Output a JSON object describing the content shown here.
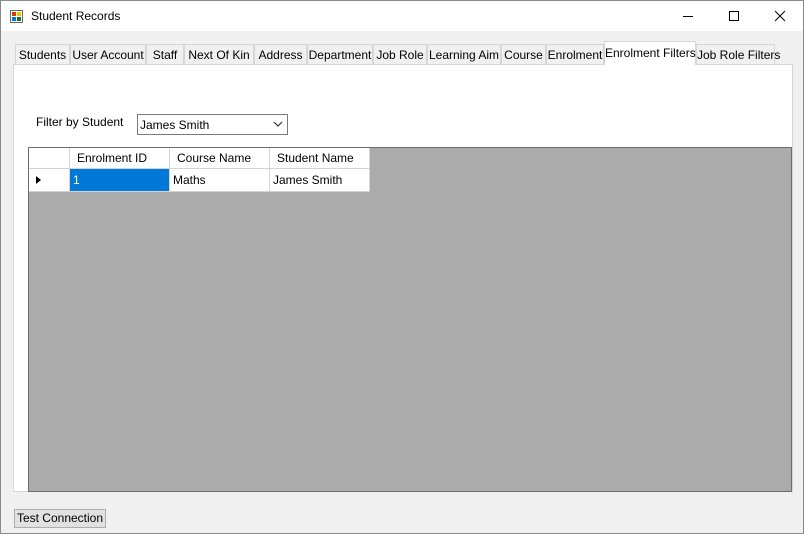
{
  "window": {
    "title": "Student Records"
  },
  "tabs": [
    {
      "label": "Students"
    },
    {
      "label": "User Account"
    },
    {
      "label": "Staff"
    },
    {
      "label": "Next Of Kin"
    },
    {
      "label": "Address"
    },
    {
      "label": "Department"
    },
    {
      "label": "Job Role"
    },
    {
      "label": "Learning Aim"
    },
    {
      "label": "Course"
    },
    {
      "label": "Enrolment"
    },
    {
      "label": "Enrolment Filters",
      "active": true
    },
    {
      "label": "Job Role Filters"
    }
  ],
  "filter": {
    "label": "Filter by Student",
    "selected": "James Smith"
  },
  "grid": {
    "columns": [
      "Enrolment ID",
      "Course Name",
      "Student Name"
    ],
    "rows": [
      [
        "1",
        "Maths",
        "James Smith"
      ]
    ]
  },
  "footer": {
    "test_button_label": "Test Connection"
  },
  "colors": {
    "selection": "#0078d7",
    "grid_background": "#ababab"
  }
}
